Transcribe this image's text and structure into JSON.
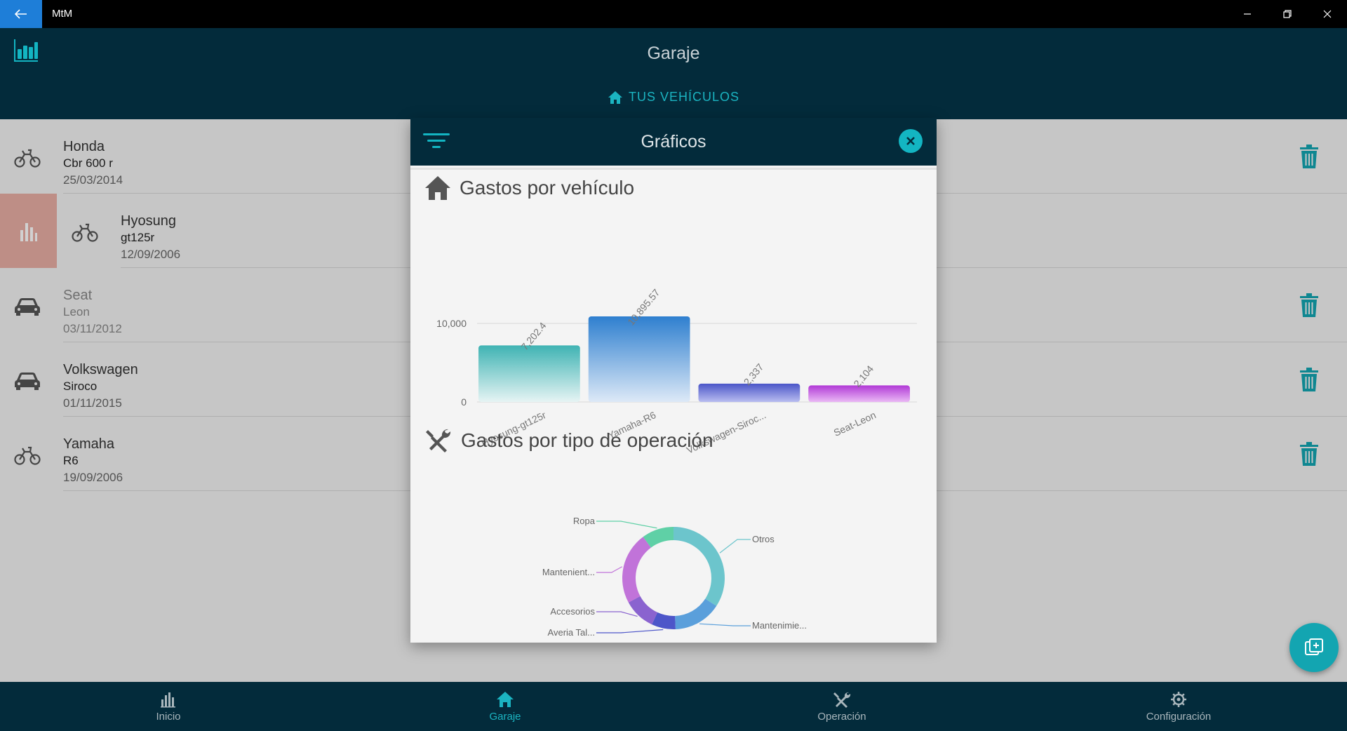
{
  "window": {
    "app_name": "MtM"
  },
  "header": {
    "title": "Garaje",
    "tab_label": "TUS VEHÍCULOS"
  },
  "vehicles": [
    {
      "brand": "Honda",
      "model": "Cbr 600 r",
      "date": "25/03/2014",
      "icon": "motorbike-icon"
    },
    {
      "brand": "Hyosung",
      "model": "gt125r",
      "date": "12/09/2006",
      "icon": "motorbike-icon"
    },
    {
      "brand": "Seat",
      "model": "Leon",
      "date": "03/11/2012",
      "icon": "car-icon"
    },
    {
      "brand": "Volkswagen",
      "model": "Siroco",
      "date": "01/11/2015",
      "icon": "car-icon"
    },
    {
      "brand": "Yamaha",
      "model": "R6",
      "date": "19/09/2006",
      "icon": "motorbike-icon"
    }
  ],
  "modal": {
    "title": "Gráficos",
    "section1_title": "Gastos por vehículo",
    "section2_title": "Gastos por tipo de operación"
  },
  "bottom_nav": [
    {
      "label": "Inicio",
      "icon": "bar-chart-icon"
    },
    {
      "label": "Garaje",
      "icon": "home-icon",
      "active": true
    },
    {
      "label": "Operación",
      "icon": "tools-icon"
    },
    {
      "label": "Configuración",
      "icon": "gear-icon"
    }
  ],
  "colors": {
    "header": "#032b3b",
    "accent": "#13b5c2",
    "trash": "#13a5b1"
  },
  "chart_data": [
    {
      "type": "bar",
      "title": "Gastos por vehículo",
      "categories": [
        "Hyosung-gt125r",
        "Yamaha-R6",
        "Volkswagen-Siroc...",
        "Seat-Leon"
      ],
      "values": [
        7202.4,
        10895.57,
        2337,
        2104
      ],
      "value_labels": [
        "7,202.4",
        "10,895.57",
        "2,337",
        "2,104"
      ],
      "y_ticks": [
        "0",
        "10,000"
      ],
      "ylim": [
        0,
        12000
      ],
      "grid": true,
      "colors": [
        [
          "#3fb3b3",
          "#e6f4f4"
        ],
        [
          "#2e7fcf",
          "#dde9f7"
        ],
        [
          "#4a55c8",
          "#b9bdf0"
        ],
        [
          "#b13ad6",
          "#eab8f5"
        ]
      ]
    },
    {
      "type": "pie",
      "title": "Gastos por tipo de operación",
      "labels": [
        "Otros",
        "Mantenimie...",
        "Averia Tal...",
        "Accesorios",
        "Mantenient...",
        "Ropa"
      ],
      "values": [
        27,
        12,
        6,
        8,
        18,
        8
      ],
      "colors": [
        "#6cc5cc",
        "#5a9fdb",
        "#4d56c9",
        "#8a63cf",
        "#c173d9",
        "#5fd0a6"
      ],
      "donut": true
    }
  ]
}
